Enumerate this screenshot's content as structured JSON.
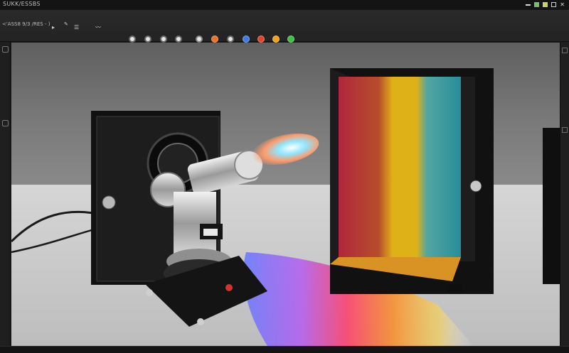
{
  "window": {
    "title": "SUKK/ESSBS"
  },
  "toolbar": {
    "left_label": "<'ASS8 9/3 /RES - )",
    "tools": [
      "rotate-tool-icon",
      "rotate-icon",
      "frame-icon",
      "brush-icon",
      "path-icon",
      "gallery-icon",
      "info-icon",
      "timer-icon",
      "settings-icon",
      "camera-icon"
    ],
    "colors": [
      {
        "name": "gray-swatch",
        "hex": "#e6e6e6"
      },
      {
        "name": "gray-swatch-2",
        "hex": "#d9d9d9"
      },
      {
        "name": "gray-swatch-3",
        "hex": "#e0e0e0"
      },
      {
        "name": "gray-swatch-4",
        "hex": "#dadada"
      },
      {
        "name": "orange-swatch",
        "hex": "#e8742a"
      },
      {
        "name": "gray-swatch-5",
        "hex": "#cfcfcf"
      },
      {
        "name": "blue-swatch",
        "hex": "#3f7de0"
      },
      {
        "name": "red-swatch",
        "hex": "#e0462c"
      },
      {
        "name": "amber-swatch",
        "hex": "#f0a11d"
      },
      {
        "name": "green-swatch",
        "hex": "#3fc046"
      }
    ]
  },
  "canvas": {
    "subject": "photo of a light source projector emitting a beam through a prism box onto a rainbow spectrum"
  }
}
